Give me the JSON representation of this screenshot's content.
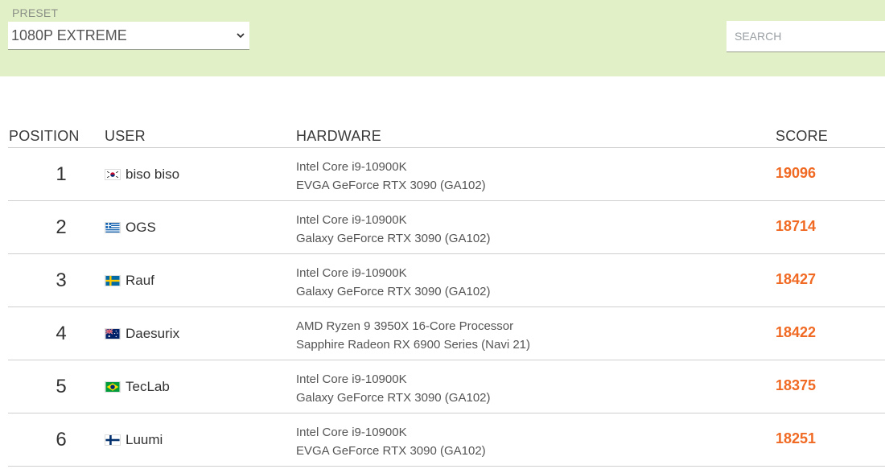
{
  "filters": {
    "preset_label": "PRESET",
    "preset_value": "1080P EXTREME",
    "search_placeholder": "SEARCH"
  },
  "table": {
    "headers": {
      "position": "POSITION",
      "user": "USER",
      "hardware": "HARDWARE",
      "score": "SCORE"
    },
    "rows": [
      {
        "position": "1",
        "flag": "south-korea-flag-icon",
        "user": "biso biso",
        "cpu": "Intel Core i9-10900K",
        "gpu": "EVGA GeForce RTX 3090 (GA102)",
        "score": "19096"
      },
      {
        "position": "2",
        "flag": "greece-flag-icon",
        "user": "OGS",
        "cpu": "Intel Core i9-10900K",
        "gpu": "Galaxy GeForce RTX 3090 (GA102)",
        "score": "18714"
      },
      {
        "position": "3",
        "flag": "sweden-flag-icon",
        "user": "Rauf",
        "cpu": "Intel Core i9-10900K",
        "gpu": "Galaxy GeForce RTX 3090 (GA102)",
        "score": "18427"
      },
      {
        "position": "4",
        "flag": "australia-flag-icon",
        "user": "Daesurix",
        "cpu": "AMD Ryzen 9 3950X 16-Core Processor",
        "gpu": "Sapphire Radeon RX 6900 Series (Navi 21)",
        "score": "18422"
      },
      {
        "position": "5",
        "flag": "brazil-flag-icon",
        "user": "TecLab",
        "cpu": "Intel Core i9-10900K",
        "gpu": "Galaxy GeForce RTX 3090 (GA102)",
        "score": "18375"
      },
      {
        "position": "6",
        "flag": "finland-flag-icon",
        "user": "Luumi",
        "cpu": "Intel Core i9-10900K",
        "gpu": "EVGA GeForce RTX 3090 (GA102)",
        "score": "18251"
      }
    ]
  },
  "colors": {
    "filter_bar_bg": "#e2f0c8",
    "score_accent": "#f06a24"
  }
}
